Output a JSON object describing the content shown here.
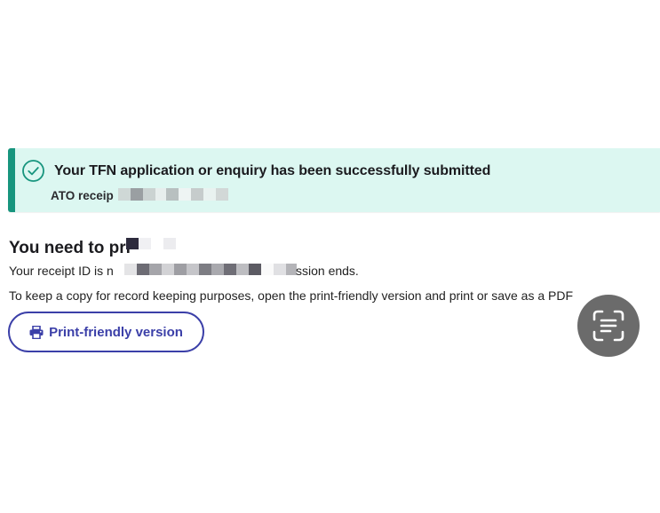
{
  "banner": {
    "title": "Your TFN application or enquiry has been successfully submitted",
    "receipt_label": "ATO receip",
    "icon": "check-circle-icon",
    "accent_color": "#17957e",
    "background_color": "#dcf7f1"
  },
  "main": {
    "heading": "You need to pri",
    "receipt_line_start": "Your receipt ID is n",
    "receipt_line_end": "ssion ends.",
    "instructions": "To keep a copy for record keeping purposes, open the print-friendly version and print or save as a PDF",
    "print_button_label": "Print-friendly version",
    "print_icon": "printer-icon",
    "button_color": "#3b3fa8"
  },
  "overlay": {
    "icon": "text-scan-icon"
  }
}
